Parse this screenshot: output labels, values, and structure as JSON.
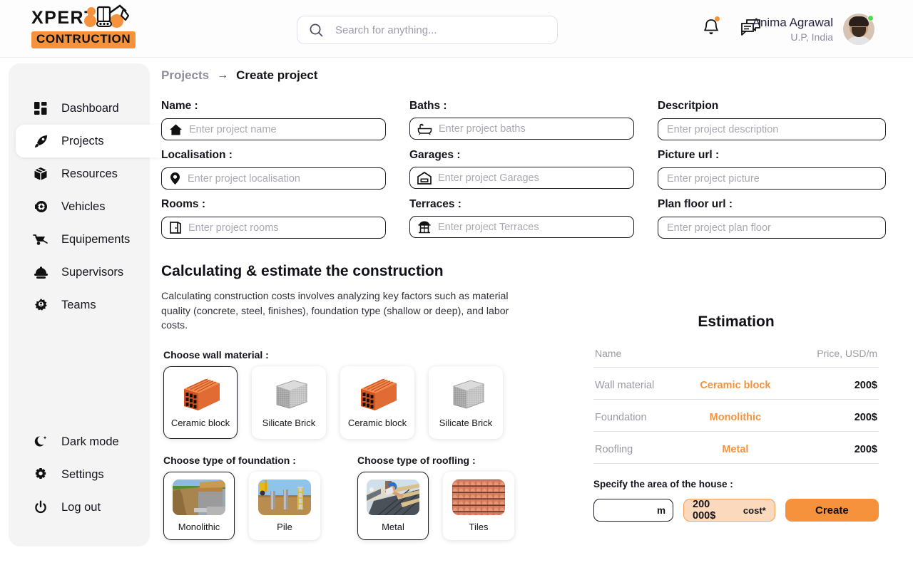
{
  "brand": {
    "name_top": "XPERT",
    "name_bottom": "CONTRUCTION",
    "accent_color": "#f6923c"
  },
  "search": {
    "placeholder": "Search for anything...",
    "value": ""
  },
  "user": {
    "name": "Anima Agrawal",
    "location": "U.P, India"
  },
  "sidebar": {
    "items": [
      {
        "label": "Dashboard",
        "icon": "dashboard-icon",
        "active": false
      },
      {
        "label": "Projects",
        "icon": "rocket-icon",
        "active": true
      },
      {
        "label": "Resources",
        "icon": "box-icon",
        "active": false
      },
      {
        "label": "Vehicles",
        "icon": "wheel-icon",
        "active": false
      },
      {
        "label": "Equipements",
        "icon": "wheelbarrow-icon",
        "active": false
      },
      {
        "label": "Supervisors",
        "icon": "helmet-icon",
        "active": false
      },
      {
        "label": "Teams",
        "icon": "gear-people-icon",
        "active": false
      }
    ],
    "bottom_items": [
      {
        "label": "Dark mode",
        "icon": "moon-icon"
      },
      {
        "label": "Settings",
        "icon": "gear-icon"
      },
      {
        "label": "Log out",
        "icon": "power-icon"
      }
    ]
  },
  "breadcrumb": {
    "parent": "Projects",
    "arrow": "→",
    "current": "Create project"
  },
  "form": {
    "fields": [
      {
        "label": "Name :",
        "placeholder": "Enter project name",
        "value": "",
        "icon": "home-icon",
        "column": "a"
      },
      {
        "label": "Localisation :",
        "placeholder": "Enter project localisation",
        "value": "",
        "icon": "pin-icon",
        "column": "a"
      },
      {
        "label": "Rooms :",
        "placeholder": "Enter project rooms",
        "value": "",
        "icon": "door-icon",
        "column": "a"
      },
      {
        "label": "Baths :",
        "placeholder": "Enter project baths",
        "value": "",
        "icon": "bathtub-icon",
        "column": "b"
      },
      {
        "label": "Garages :",
        "placeholder": "Enter project Garages",
        "value": "",
        "icon": "garage-icon",
        "column": "b"
      },
      {
        "label": "Terraces :",
        "placeholder": "Enter project Terraces",
        "value": "",
        "icon": "terrace-icon",
        "column": "b"
      },
      {
        "label": "Descritpion",
        "placeholder": "Enter project description",
        "value": "",
        "icon": "",
        "column": "c"
      },
      {
        "label": "Picture url :",
        "placeholder": "Enter project picture",
        "value": "",
        "icon": "",
        "column": "c"
      },
      {
        "label": "Plan floor url :",
        "placeholder": "Enter project plan floor",
        "value": "",
        "icon": "",
        "column": "c"
      }
    ]
  },
  "calc": {
    "title": "Calculating & estimate the construction",
    "description": "Calculating construction costs involves analyzing key factors such as material quality (concrete, steel, finishes), foundation type (shallow or deep), and labor costs.",
    "wall_label": "Choose wall material :",
    "wall_options": [
      {
        "label": "Ceramic block",
        "type": "ceramic",
        "selected": true
      },
      {
        "label": "Silicate Brick",
        "type": "silicate",
        "selected": false
      },
      {
        "label": "Ceramic block",
        "type": "ceramic",
        "selected": false
      },
      {
        "label": "Silicate Brick",
        "type": "silicate",
        "selected": false
      }
    ],
    "foundation_label": "Choose type of foundation :",
    "foundation_options": [
      {
        "label": "Monolithic",
        "type": "monolithic",
        "selected": true
      },
      {
        "label": "Pile",
        "type": "pile",
        "selected": false
      }
    ],
    "roofing_label": "Choose type of roofling :",
    "roofing_options": [
      {
        "label": "Metal",
        "type": "metal",
        "selected": true
      },
      {
        "label": "Tiles",
        "type": "tiles",
        "selected": false
      }
    ]
  },
  "estimation": {
    "title": "Estimation",
    "col_name": "Name",
    "col_price": "Price, USD/m",
    "rows": [
      {
        "name": "Wall material",
        "value": "Ceramic block",
        "price": "200$"
      },
      {
        "name": "Foundation",
        "value": "Monolithic",
        "price": "200$"
      },
      {
        "name": "Roofling",
        "value": "Metal",
        "price": "200$"
      }
    ],
    "area_label": "Specify the area of the house :",
    "area_value": "",
    "area_placeholder": "",
    "area_unit": "m",
    "cost_value": "200 000$",
    "cost_suffix": "cost*",
    "create_label": "Create",
    "accent_color": "#f6923c"
  }
}
